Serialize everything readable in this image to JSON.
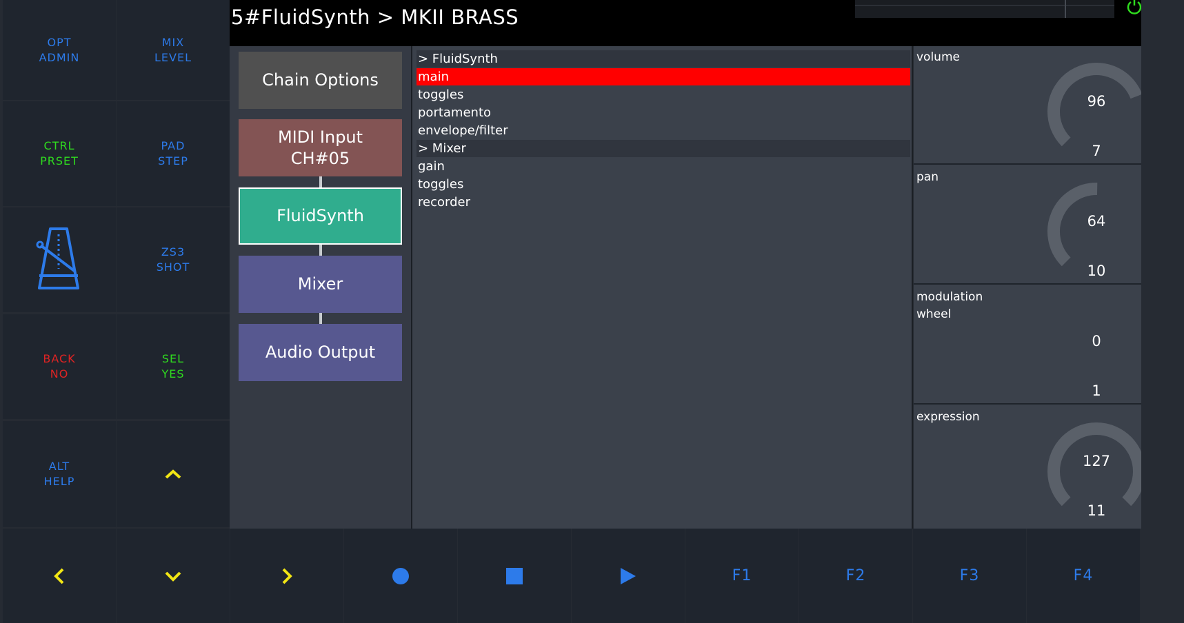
{
  "header": {
    "title": "5#FluidSynth > MKII BRASS"
  },
  "left_buttons": {
    "opt_admin": "OPT\nADMIN",
    "mix_level": "MIX\nLEVEL",
    "ctrl_prset": "CTRL\nPRSET",
    "pad_step": "PAD\nSTEP",
    "metronome_icon": "metronome-icon",
    "zs3_shot": "ZS3\nSHOT",
    "back_no": "BACK\nNO",
    "sel_yes": "SEL\nYES",
    "alt_help": "ALT\nHELP",
    "up_icon": "chevron-up-icon"
  },
  "bottom_buttons": {
    "f1": "F1",
    "f2": "F2",
    "f3": "F3",
    "f4": "F4"
  },
  "chain": {
    "chain_options": "Chain Options",
    "midi_input": "MIDI Input\nCH#05",
    "fluidsynth": "FluidSynth",
    "mixer": "Mixer",
    "audio_output": "Audio Output"
  },
  "menu": {
    "items": [
      "> FluidSynth",
      "main",
      "toggles",
      "portamento",
      "envelope/filter",
      "> Mixer",
      "gain",
      "toggles",
      "recorder"
    ]
  },
  "knobs": [
    {
      "label": "volume",
      "value": "96",
      "number": "7",
      "level": 96,
      "max": 127
    },
    {
      "label": "pan",
      "value": "64",
      "number": "10",
      "level": 64,
      "max": 127
    },
    {
      "label": "modulation\nwheel",
      "value": "0",
      "number": "1",
      "level": 0,
      "max": 127
    },
    {
      "label": "expression",
      "value": "127",
      "number": "11",
      "level": 127,
      "max": 127
    }
  ],
  "colors": {
    "blue": "#2d7bea",
    "green": "#2fdb1f",
    "red": "#e02323",
    "yellow": "#f2e614",
    "selected": "#ff0000",
    "chain_options": "#505050",
    "midi_input": "#835454",
    "fluidsynth": "#30ad8e",
    "mixer": "#575890"
  }
}
